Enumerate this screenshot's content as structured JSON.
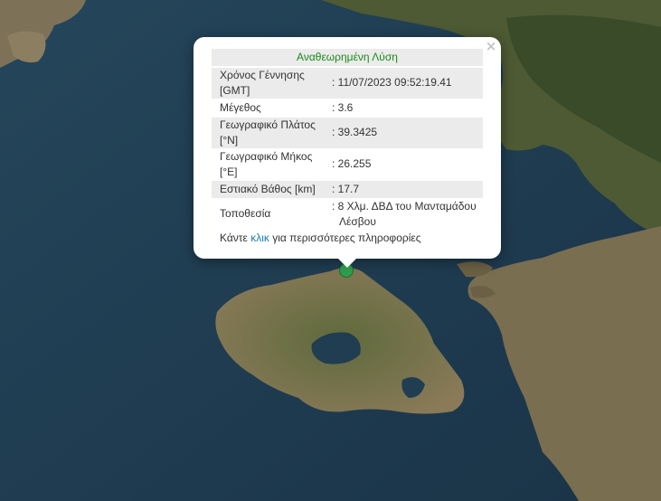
{
  "popup": {
    "title": "Αναθεωρημένη Λύση",
    "title_color": "#1a8a1a",
    "close_symbol": "×",
    "rows": [
      {
        "label1": "Χρόνος Γέννησης",
        "label2": "[GMT]",
        "value1": ": 11/07/2023 09:52:19.41",
        "value2": ""
      },
      {
        "label1": "Μέγεθος",
        "label2": "",
        "value1": ": 3.6",
        "value2": ""
      },
      {
        "label1": "Γεωγραφικό Πλάτος",
        "label2": "[°N]",
        "value1": ": 39.3425",
        "value2": ""
      },
      {
        "label1": "Γεωγραφικό Μήκος",
        "label2": "[°E]",
        "value1": ": 26.255",
        "value2": ""
      },
      {
        "label1": "Εστιακό Βάθος [km]",
        "label2": "",
        "value1": ": 17.7",
        "value2": ""
      },
      {
        "label1": "Τοποθεσία",
        "label2": "",
        "value1": ": 8 Χλμ. ΔΒΔ του Μανταμάδου",
        "value2": "Λέσβου"
      }
    ],
    "more_before": "Κάντε ",
    "more_link": "κλικ",
    "more_after": " για περισσότερες πληροφορίες",
    "link_color": "#1a7bb8"
  },
  "marker": {
    "color": "#2f9e4e",
    "icon": "earthquake-epicenter-marker"
  }
}
